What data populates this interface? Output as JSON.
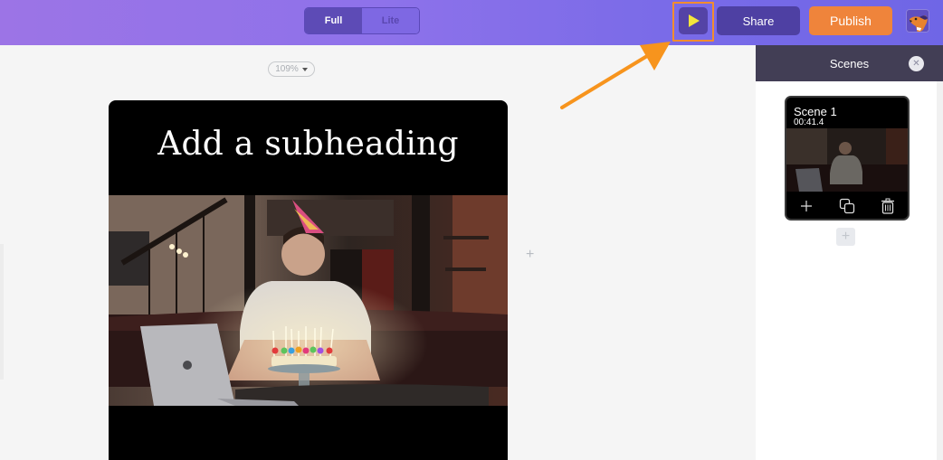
{
  "topbar": {
    "modes": [
      {
        "label": "Full",
        "active": true
      },
      {
        "label": "Lite",
        "active": false
      }
    ],
    "play_icon": "play-icon",
    "share_label": "Share",
    "publish_label": "Publish",
    "avatar_icon": "dog-mascot-avatar",
    "colors": {
      "accent_orange": "#ef843b",
      "play_yellow": "#f3e53b",
      "highlight_orange": "#f28d2e"
    }
  },
  "canvas": {
    "zoom_level": "109%",
    "subheading": "Add a subheading",
    "add_scene_icon": "plus-icon"
  },
  "scenes_panel": {
    "title": "Scenes",
    "close_icon": "close-icon",
    "scenes": [
      {
        "title": "Scene 1",
        "duration": "00:41.4",
        "actions": [
          "add-icon",
          "duplicate-icon",
          "trash-icon"
        ]
      }
    ],
    "add_scene_icon": "plus-icon"
  }
}
